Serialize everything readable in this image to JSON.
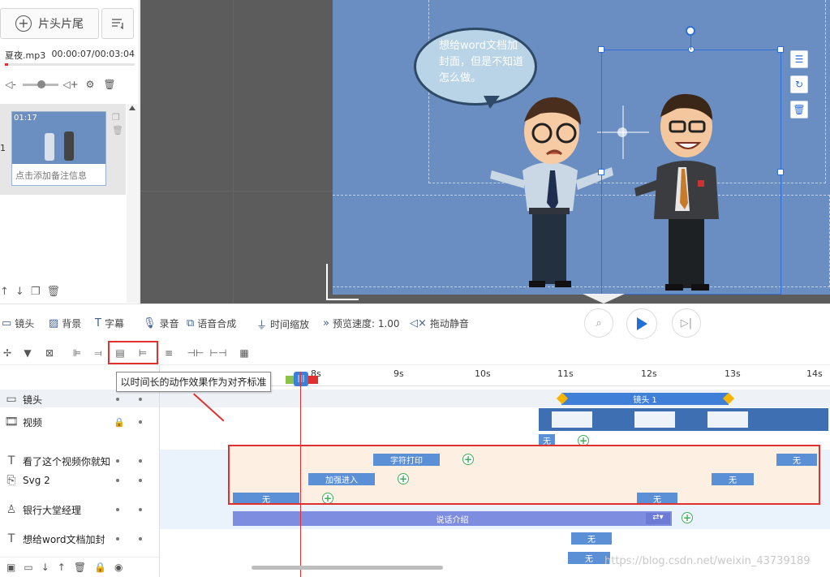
{
  "left_panel": {
    "head_tail_button": "片头片尾",
    "audio": {
      "name": "夏夜.mp3",
      "time": "00:00:07/00:03:04"
    },
    "scene": {
      "index": "1",
      "duration": "01:17",
      "note_placeholder": "点击添加备注信息"
    }
  },
  "canvas": {
    "bubble_text": "想给word文档加封面，但是不知道怎么做。"
  },
  "toolbar": {
    "items": [
      "镜头",
      "背景",
      "字幕",
      "录音",
      "语音合成",
      "时间缩放",
      "预览速度: 1.00",
      "拖动静音"
    ]
  },
  "tooltip": "以时间长的动作效果作为对齐标准",
  "timeline": {
    "ticks": [
      "8s",
      "9s",
      "10s",
      "11s",
      "12s",
      "13s",
      "14s"
    ],
    "tracks": [
      {
        "icon": "camera-icon",
        "name": "镜头"
      },
      {
        "icon": "film-icon",
        "name": "视频"
      },
      {
        "icon": "text-icon",
        "name": "看了这个视频你就知"
      },
      {
        "icon": "svg-icon",
        "name": "Svg 2"
      },
      {
        "icon": "person-icon",
        "name": "银行大堂经理"
      },
      {
        "icon": "text-icon",
        "name": "想给word文档加封"
      }
    ],
    "clips": {
      "camera": "镜头 1",
      "video_none": "无",
      "typing": "字符打印",
      "text_end": "无",
      "zoom_in": "加强进入",
      "svg_end": "无",
      "manager_start": "无",
      "manager_mid": "无",
      "speech": "说话介绍",
      "word_none": "无",
      "last_none": "无"
    }
  },
  "watermark": "https://blog.csdn.net/weixin_43739189",
  "colors": {
    "canvas_bg": "#6a8dc2",
    "clip_blue": "#5b8fd6",
    "highlight_red": "#e0312f",
    "keyframe_green": "#3fae5b"
  }
}
